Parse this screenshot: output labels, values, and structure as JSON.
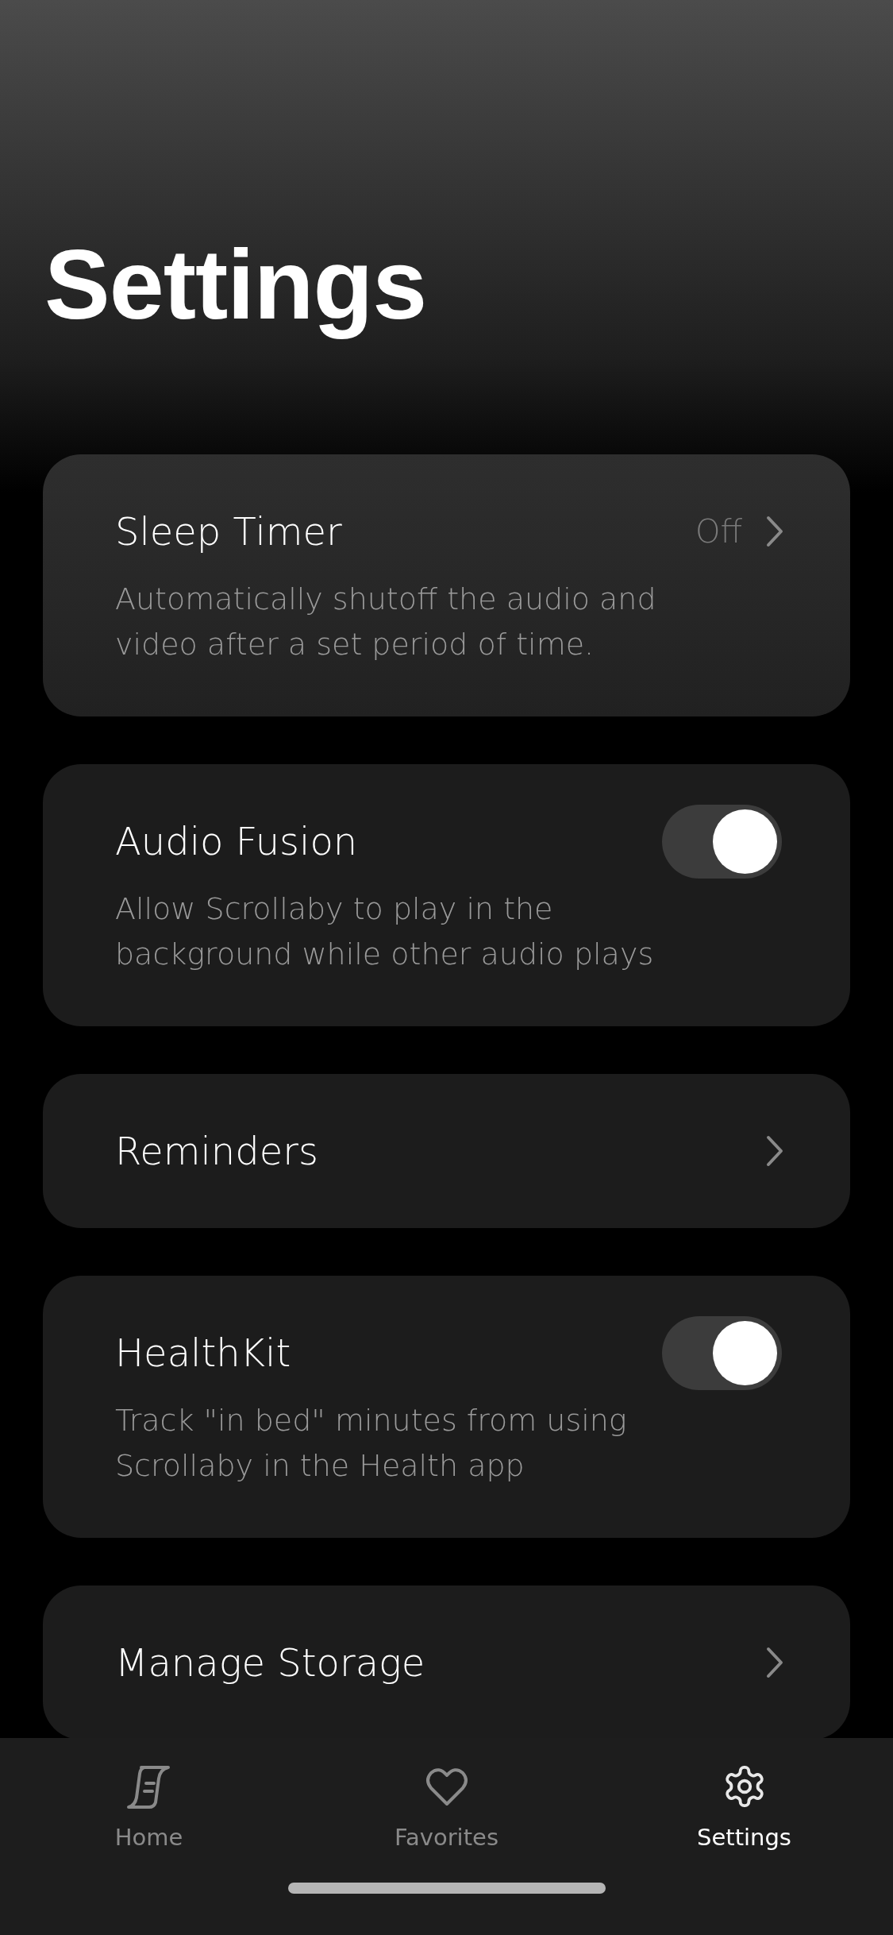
{
  "title": "Settings",
  "settings": [
    {
      "kind": "link",
      "label": "Sleep Timer",
      "value": "Off",
      "description": "Automatically shutoff the audio and video after a set period of time."
    },
    {
      "kind": "toggle",
      "label": "Audio Fusion",
      "on": true,
      "description": "Allow Scrollaby to play in the background while other audio plays"
    },
    {
      "kind": "link",
      "label": "Reminders"
    },
    {
      "kind": "toggle",
      "label": "HealthKit",
      "on": true,
      "description": "Track \"in bed\" minutes from using Scrollaby in the Health app"
    },
    {
      "kind": "link",
      "label": "Manage Storage"
    }
  ],
  "tabs": [
    {
      "kind": "home",
      "label": "Home",
      "selected": false
    },
    {
      "kind": "favorites",
      "label": "Favorites",
      "selected": false
    },
    {
      "kind": "settings",
      "label": "Settings",
      "selected": true
    }
  ]
}
